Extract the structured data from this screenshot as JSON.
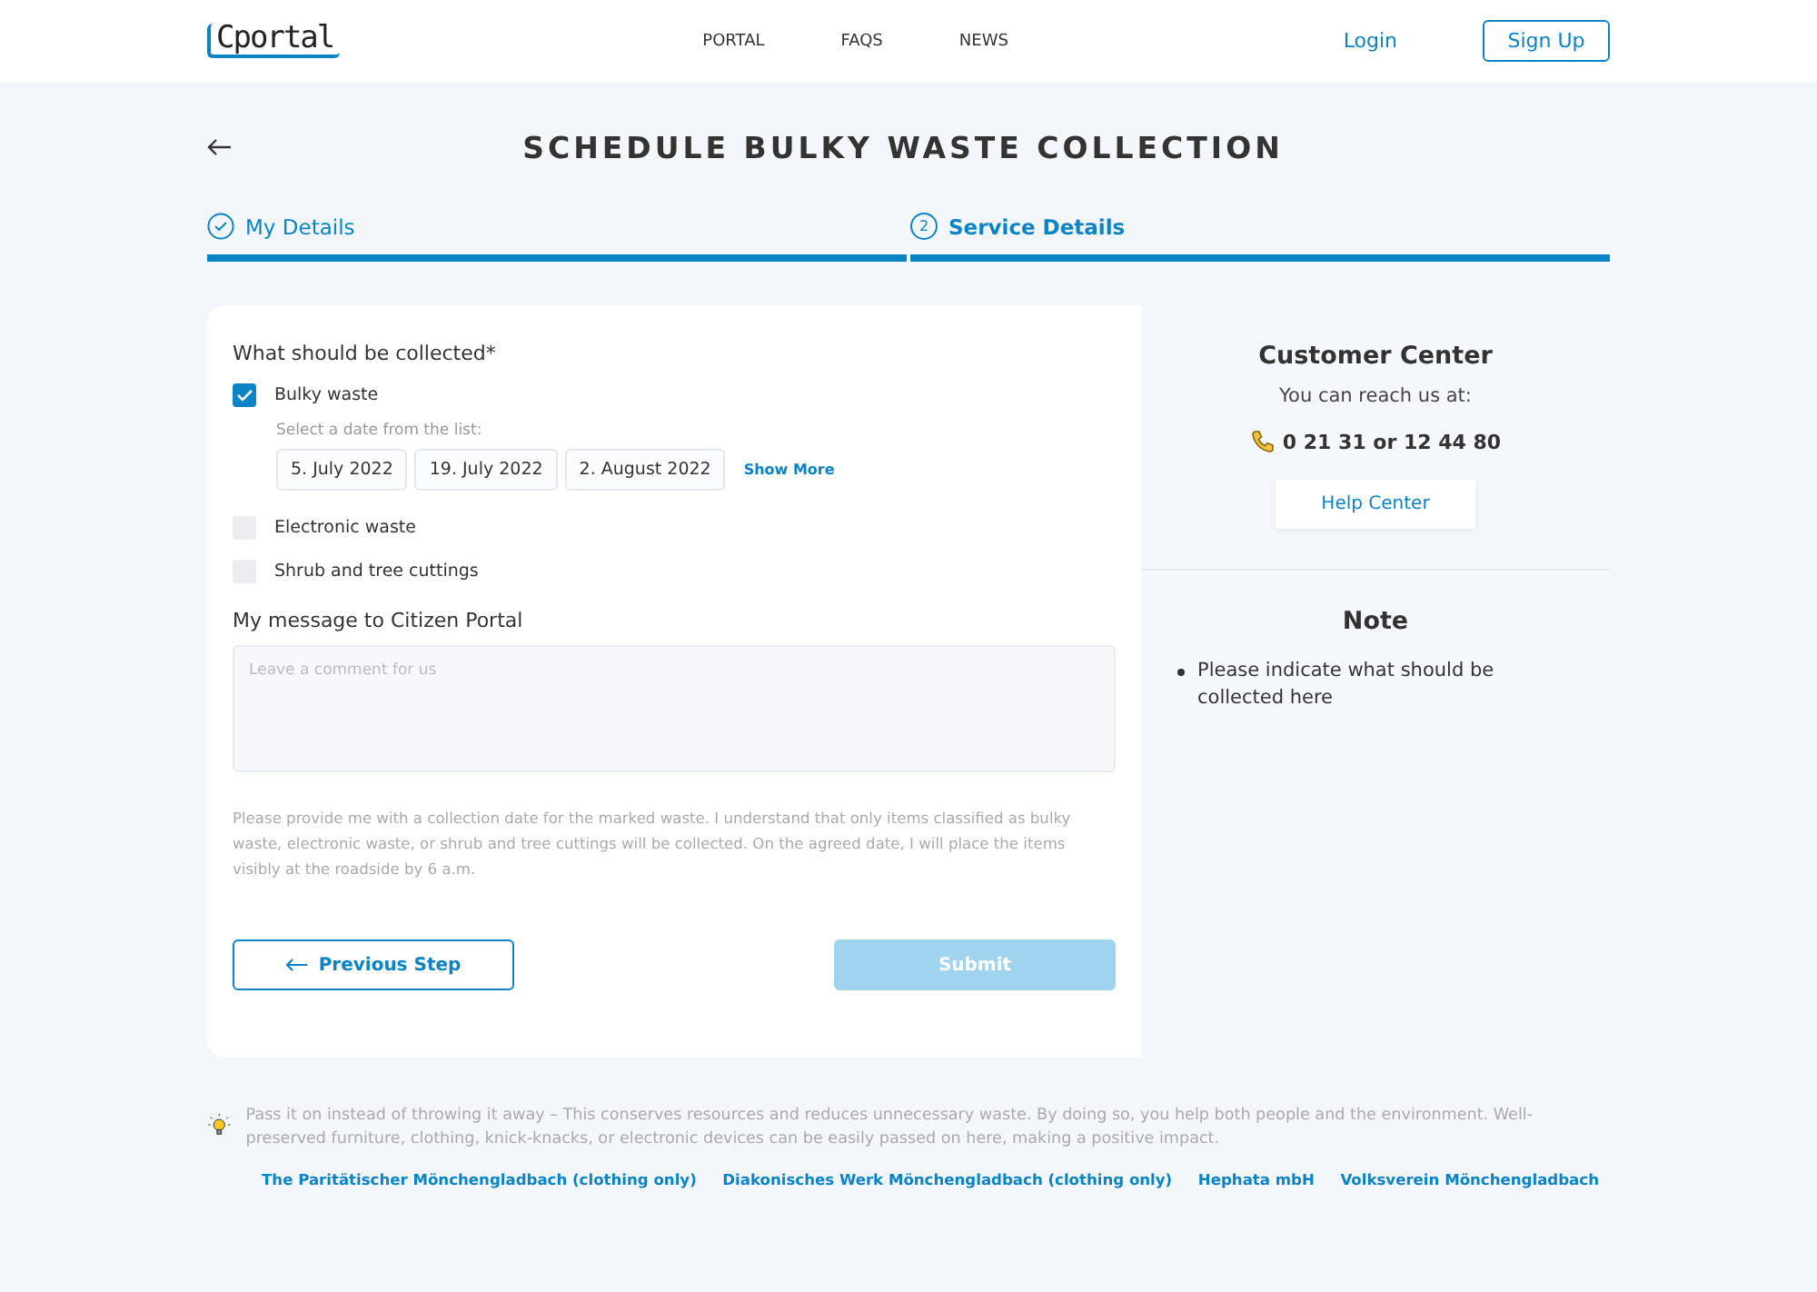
{
  "header": {
    "logo": "Cportal",
    "nav": [
      {
        "label": "PORTAL"
      },
      {
        "label": "FAQS"
      },
      {
        "label": "NEWS"
      }
    ],
    "login": "Login",
    "signup": "Sign Up"
  },
  "title": "SCHEDULE BULKY WASTE COLLECTION",
  "steps": [
    {
      "label": "My Details",
      "completed": true,
      "selected": false
    },
    {
      "label": "Service Details",
      "number": "2",
      "completed": false,
      "selected": true
    }
  ],
  "form": {
    "question": "What should be collected*",
    "options": [
      {
        "label": "Bulky waste",
        "checked": true,
        "date_hint": "Select a date from the list:",
        "dates": [
          {
            "label": "5. July 2022",
            "selected": false
          },
          {
            "label": "19. July 2022",
            "selected": false
          },
          {
            "label": "2. August 2022",
            "selected": false
          }
        ],
        "show_more": "Show More"
      },
      {
        "label": "Electronic waste",
        "checked": false
      },
      {
        "label": "Shrub and tree cuttings",
        "checked": false
      }
    ],
    "message_label": "My message to Citizen Portal",
    "message_placeholder": "Leave a comment for us",
    "consent": "Please provide me with a collection date for the marked waste. I understand that only items classified as bulky waste, electronic waste, or shrub and tree cuttings will be collected. On the agreed date, I will place the items visibly at the roadside by 6 a.m.",
    "previous": "Previous Step",
    "submit": "Submit",
    "submit_disabled": true
  },
  "customer_center": {
    "title": "Customer Center",
    "reach": "You can reach us at:",
    "phone": "0 21 31 or 12 44 80",
    "help": "Help Center"
  },
  "note": {
    "title": "Note",
    "items": [
      "Please indicate what should be collected here"
    ]
  },
  "footer": {
    "text": "Pass it on instead of throwing it away – This conserves resources and reduces unnecessary waste. By doing so, you help both people and the environment. Well-preserved furniture, clothing, knick-knacks, or electronic devices can be easily passed on here, making a positive impact.",
    "links": [
      "The Paritätischer Mönchengladbach (clothing only)",
      "Diakonisches Werk Mönchengladbach (clothing only)",
      "Hephata mbH",
      "Volksverein Mönchengladbach"
    ]
  }
}
